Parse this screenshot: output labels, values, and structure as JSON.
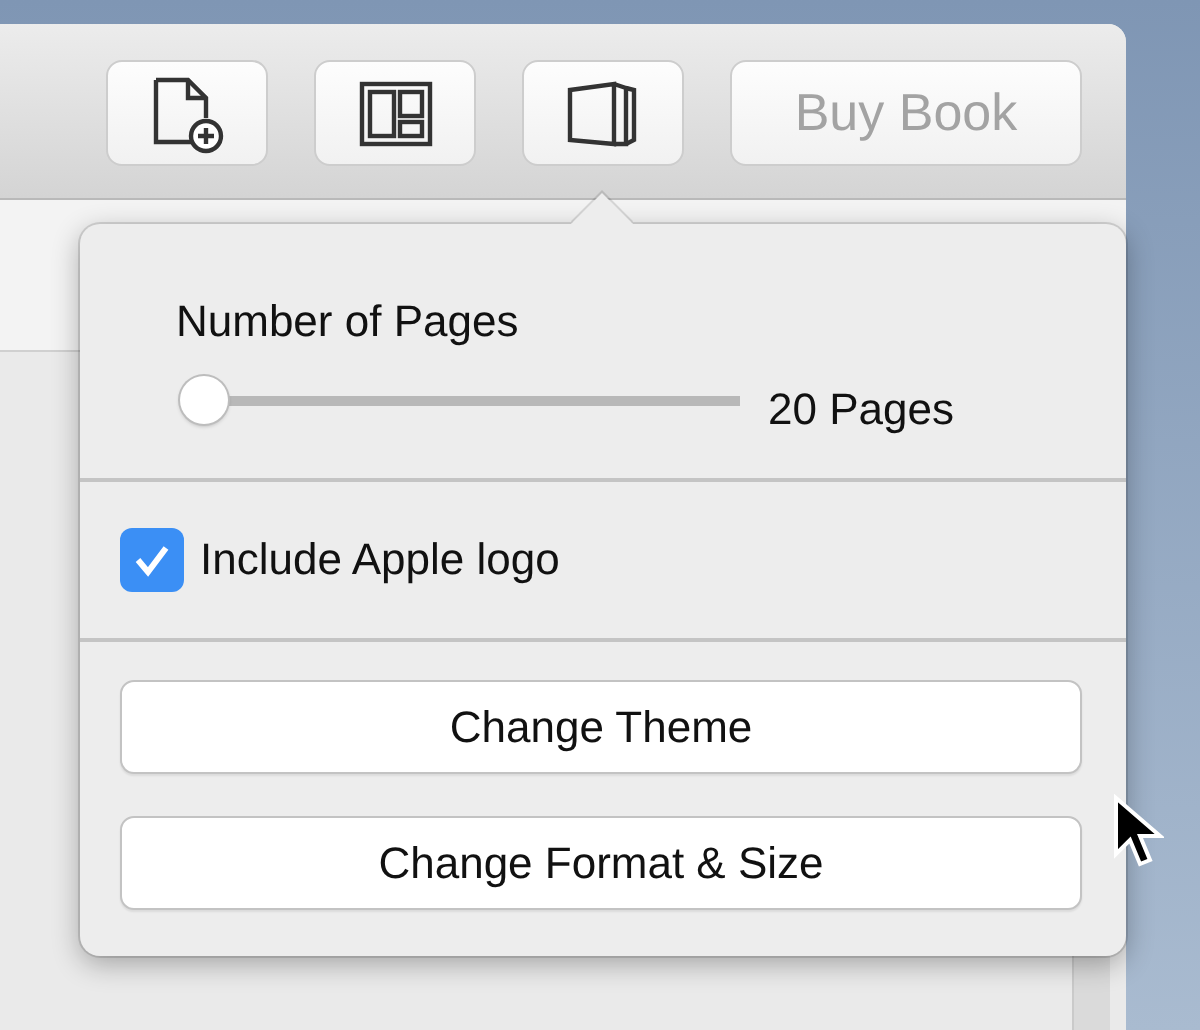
{
  "toolbar": [
    {
      "kind": "add-page",
      "disabled": false
    },
    {
      "kind": "layout",
      "disabled": false
    },
    {
      "kind": "book",
      "disabled": false
    },
    {
      "kind": "text",
      "label": "Buy Book",
      "disabled": true
    }
  ],
  "popover": {
    "slider": {
      "label": "Number of Pages",
      "level": 0,
      "reading": "20 Pages"
    },
    "checkbox": {
      "label": "Include Apple logo",
      "checked": true
    },
    "buttons": [
      "Change Theme",
      "Change Format & Size"
    ]
  }
}
